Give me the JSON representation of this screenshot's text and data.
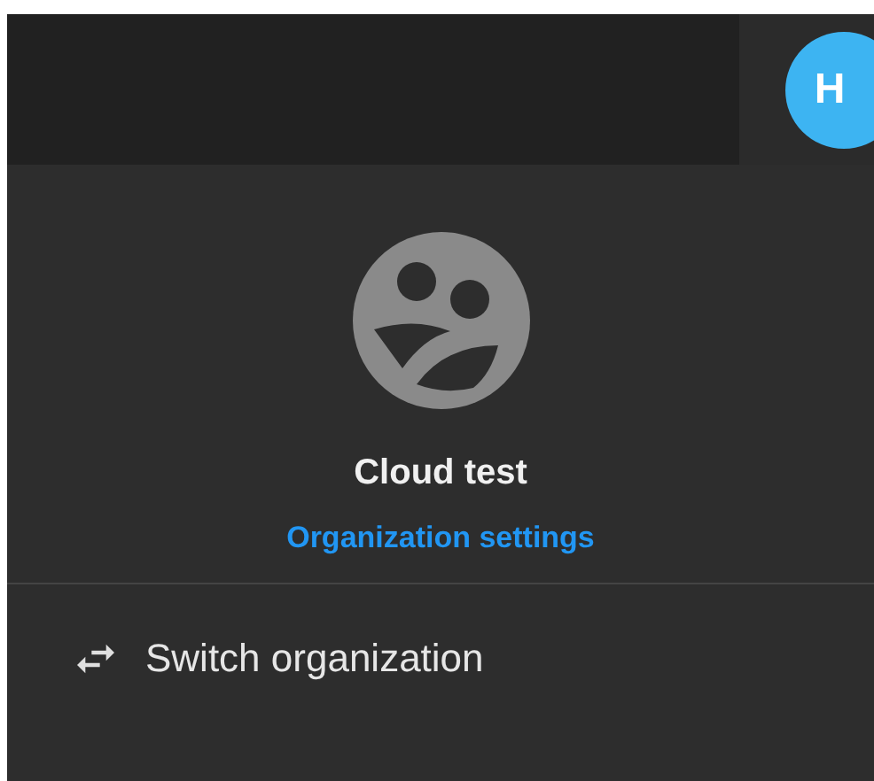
{
  "header": {
    "avatar_letter": "H"
  },
  "organization": {
    "name": "Cloud test",
    "settings_link": "Organization settings"
  },
  "menu_items": [
    {
      "label": "Switch organization",
      "kind": "switch"
    }
  ]
}
